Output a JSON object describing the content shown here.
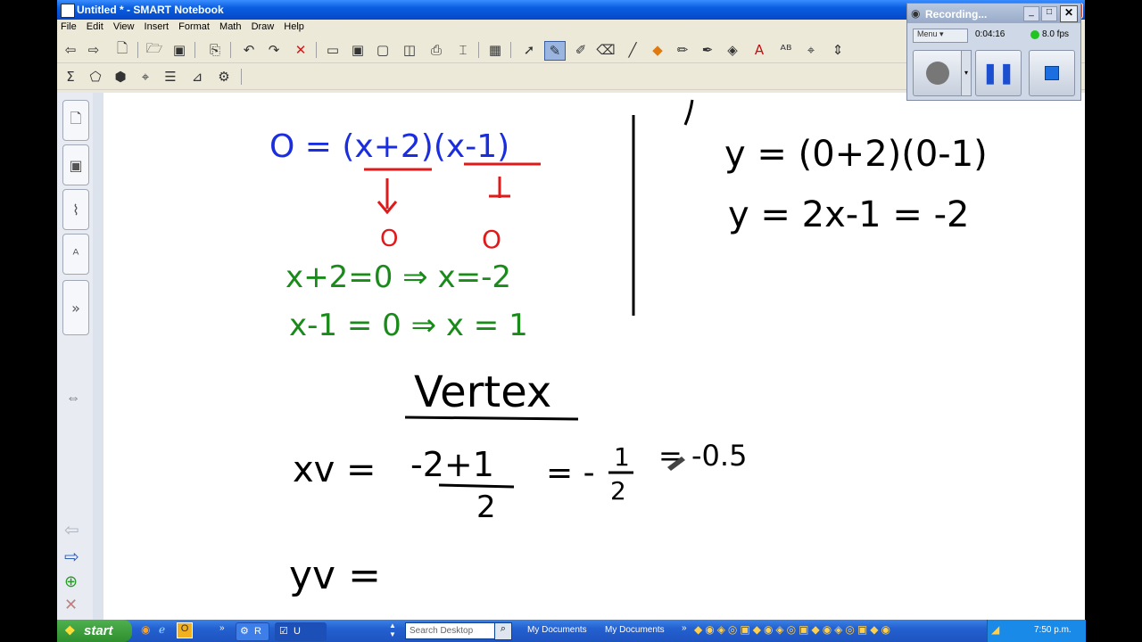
{
  "window": {
    "title": "Untitled * - SMART Notebook",
    "menu": [
      "File",
      "Edit",
      "View",
      "Insert",
      "Format",
      "Math",
      "Draw",
      "Help"
    ]
  },
  "recorder": {
    "title": "Recording...",
    "menu_label": "Menu",
    "elapsed": "0:04:16",
    "fps": "8.0 fps",
    "status_color": "#22c322"
  },
  "handwriting": {
    "eq1": "O = (x+2)(x-1)",
    "zero_a": "O",
    "zero_b": "O",
    "sol1": "x+2=0  ⇒ x=-2",
    "sol2": "x-1 = 0   ⇒ x = 1",
    "yline1": "y = (0+2)(0-1)",
    "yline2": "y = 2x-1 = -2",
    "vertex": "Vertex",
    "xv_lhs": "xv =",
    "xv_num": "-2+1",
    "xv_den": "2",
    "xv_mid": "= -",
    "half_num": "1",
    "half_den": "2",
    "xv_result": "= -0.5",
    "yv": "yv =",
    "colors": {
      "blue": "#1a2ee0",
      "red": "#e01a1a",
      "green": "#1a8a1a",
      "black": "#000000"
    }
  },
  "taskbar": {
    "start": "start",
    "task1": "R",
    "task2": "U",
    "search_placeholder": "Search Desktop",
    "link1": "My Documents",
    "link2": "My Documents",
    "clock": "7:50 p.m."
  }
}
